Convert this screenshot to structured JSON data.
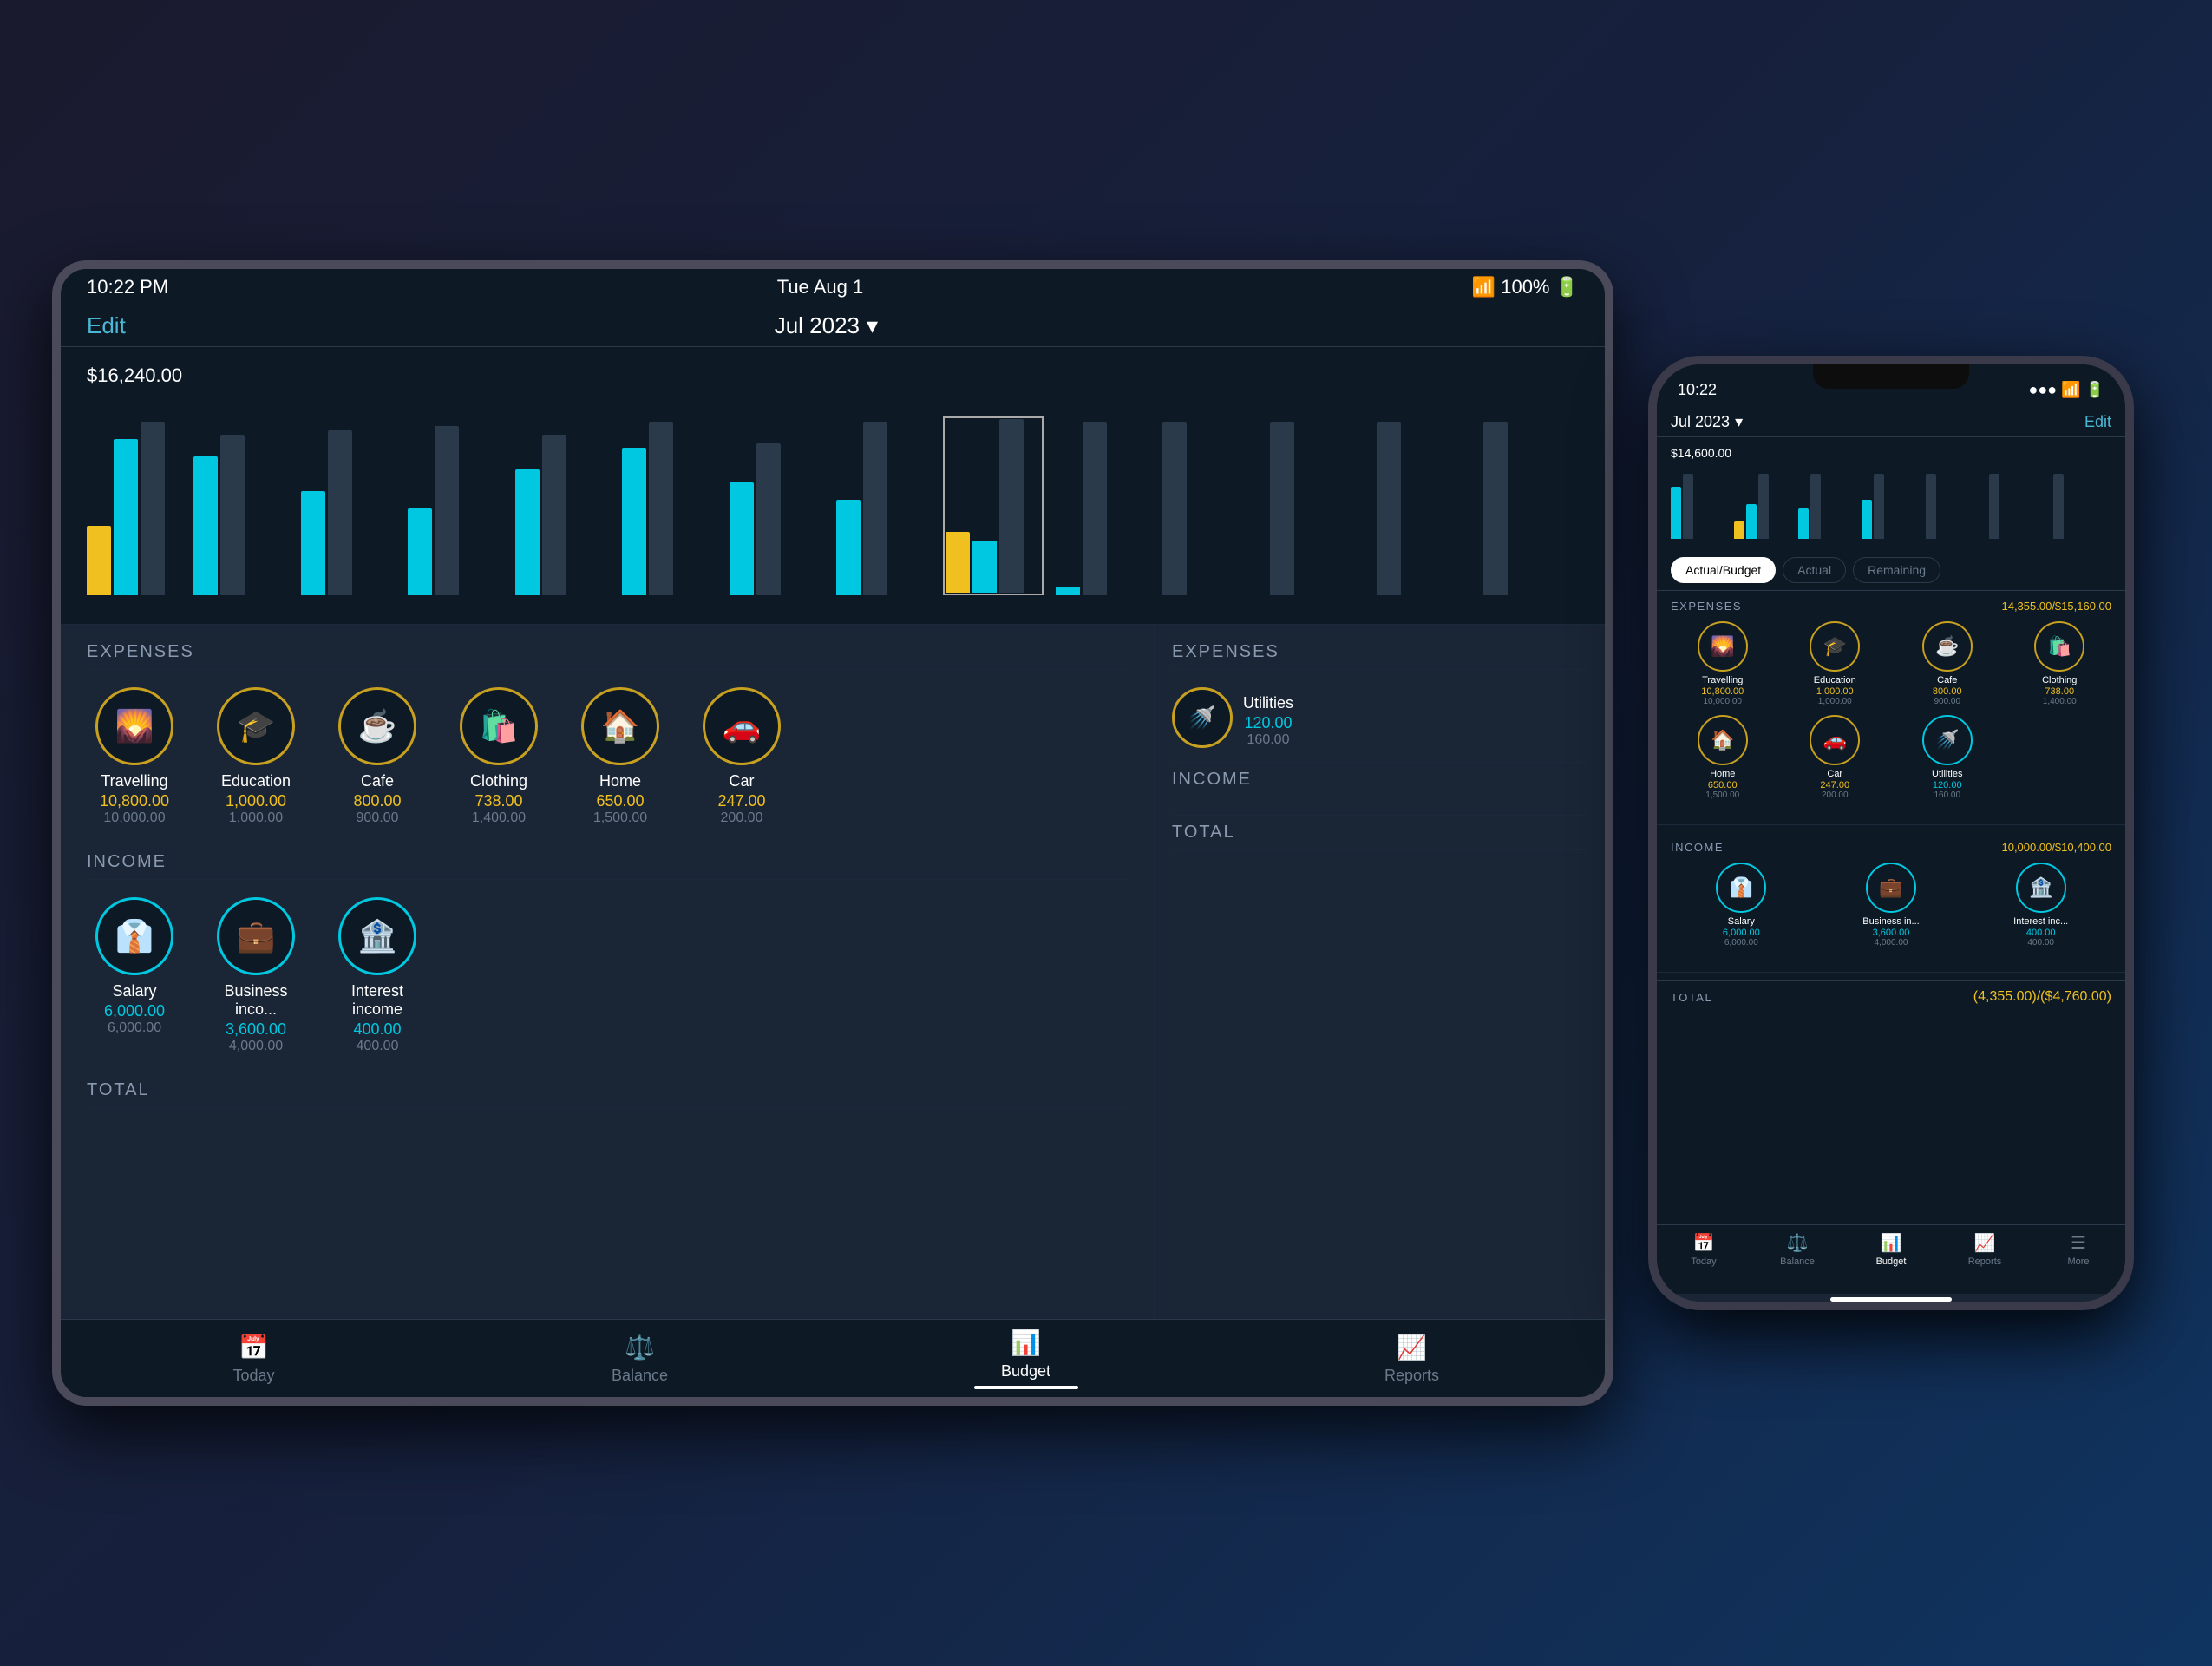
{
  "scene": {
    "background": "#1a2535"
  },
  "tablet": {
    "status_bar": {
      "time": "10:22 PM",
      "date": "Tue Aug 1",
      "wifi": "WiFi",
      "battery": "100%"
    },
    "nav": {
      "edit_label": "Edit",
      "month_label": "Jul 2023",
      "chevron": "▾"
    },
    "chart": {
      "max_label": "$16,240.00",
      "bars": [
        {
          "cyan": 180,
          "dark": 200,
          "yellow": 80
        },
        {
          "cyan": 160,
          "dark": 180,
          "yellow": 0
        },
        {
          "cyan": 120,
          "dark": 190,
          "yellow": 0
        },
        {
          "cyan": 100,
          "dark": 195,
          "yellow": 0
        },
        {
          "cyan": 145,
          "dark": 185,
          "yellow": 0
        },
        {
          "cyan": 170,
          "dark": 200,
          "yellow": 0
        },
        {
          "cyan": 130,
          "dark": 175,
          "yellow": 0
        },
        {
          "cyan": 110,
          "dark": 200,
          "yellow": 0
        },
        {
          "cyan": 60,
          "dark": 200,
          "yellow": 70
        },
        {
          "cyan": 10,
          "dark": 200,
          "yellow": 0
        },
        {
          "cyan": 0,
          "dark": 200,
          "yellow": 0
        },
        {
          "cyan": 0,
          "dark": 200,
          "yellow": 0
        },
        {
          "cyan": 0,
          "dark": 200,
          "yellow": 0
        },
        {
          "cyan": 0,
          "dark": 200,
          "yellow": 0
        }
      ]
    },
    "expenses_section": {
      "title": "EXPENSES",
      "categories": [
        {
          "name": "Travelling",
          "actual": "10,800.00",
          "budget": "10,000.00",
          "icon": "🌄",
          "color": "yellow"
        },
        {
          "name": "Education",
          "actual": "1,000.00",
          "budget": "1,000.00",
          "icon": "🎓",
          "color": "yellow"
        },
        {
          "name": "Cafe",
          "actual": "800.00",
          "budget": "900.00",
          "icon": "☕",
          "color": "yellow"
        },
        {
          "name": "Clothing",
          "actual": "738.00",
          "budget": "1,400.00",
          "icon": "🛍️",
          "color": "yellow"
        },
        {
          "name": "Home",
          "actual": "650.00",
          "budget": "1,500.00",
          "icon": "🏠",
          "color": "yellow"
        },
        {
          "name": "Car",
          "actual": "247.00",
          "budget": "200.00",
          "icon": "🚗",
          "color": "yellow"
        },
        {
          "name": "Utilities",
          "actual": "120.00",
          "budget": "160.00",
          "icon": "🚿",
          "color": "cyan"
        }
      ]
    },
    "income_section": {
      "title": "INCOME",
      "categories": [
        {
          "name": "Salary",
          "actual": "6,000.00",
          "budget": "6,000.00",
          "icon": "👔",
          "color": "yellow"
        },
        {
          "name": "Business inco...",
          "actual": "3,600.00",
          "budget": "4,000.00",
          "icon": "💼",
          "color": "yellow"
        },
        {
          "name": "Interest income",
          "actual": "400.00",
          "budget": "400.00",
          "icon": "🏦",
          "color": "yellow"
        }
      ]
    },
    "total_section": {
      "title": "TOTAL"
    },
    "tab_bar": {
      "items": [
        {
          "label": "Today",
          "icon": "📅",
          "active": false
        },
        {
          "label": "Balance",
          "icon": "⚖️",
          "active": false
        },
        {
          "label": "Budget",
          "icon": "📊",
          "active": true
        },
        {
          "label": "Reports",
          "icon": "📈",
          "active": false
        }
      ]
    }
  },
  "phone": {
    "status_bar": {
      "time": "10:22",
      "signal": "●●●",
      "wifi": "WiFi",
      "battery": "🔋"
    },
    "nav": {
      "month_label": "Jul 2023",
      "chevron": "▾",
      "edit_label": "Edit"
    },
    "chart": {
      "max_label": "$14,600.00"
    },
    "filter": {
      "buttons": [
        {
          "label": "Actual/Budget",
          "active": true
        },
        {
          "label": "Actual",
          "active": false
        },
        {
          "label": "Remaining",
          "active": false
        }
      ]
    },
    "expenses_section": {
      "title": "EXPENSES",
      "amount": "14,355.00/$15,160.00",
      "categories": [
        {
          "name": "Travelling",
          "actual": "10,800.00",
          "budget": "10,000.00",
          "icon": "🌄",
          "color": "yellow"
        },
        {
          "name": "Education",
          "actual": "1,000.00",
          "budget": "1,000.00",
          "icon": "🎓",
          "color": "yellow"
        },
        {
          "name": "Cafe",
          "actual": "800.00",
          "budget": "900.00",
          "icon": "☕",
          "color": "yellow"
        },
        {
          "name": "Clothing",
          "actual": "738.00",
          "budget": "1,400.00",
          "icon": "🛍️",
          "color": "yellow"
        },
        {
          "name": "Home",
          "actual": "650.00",
          "budget": "1,500.00",
          "icon": "🏠",
          "color": "yellow"
        },
        {
          "name": "Car",
          "actual": "247.00",
          "budget": "200.00",
          "icon": "🚗",
          "color": "yellow"
        },
        {
          "name": "Utilities",
          "actual": "120.00",
          "budget": "160.00",
          "icon": "🚿",
          "color": "cyan"
        }
      ]
    },
    "income_section": {
      "title": "INCOME",
      "amount": "10,000.00/$10,400.00",
      "categories": [
        {
          "name": "Salary",
          "actual": "6,000.00",
          "budget": "6,000.00",
          "icon": "👔",
          "color": "yellow"
        },
        {
          "name": "Business in...",
          "actual": "3,600.00",
          "budget": "4,000.00",
          "icon": "💼",
          "color": "yellow"
        },
        {
          "name": "Interest inc...",
          "actual": "400.00",
          "budget": "400.00",
          "icon": "🏦",
          "color": "yellow"
        }
      ]
    },
    "total_section": {
      "title": "TOTAL",
      "amount": "(4,355.00)/($4,760.00)"
    },
    "tab_bar": {
      "items": [
        {
          "label": "Today",
          "icon": "📅",
          "active": false
        },
        {
          "label": "Balance",
          "icon": "⚖️",
          "active": false
        },
        {
          "label": "Budget",
          "icon": "📊",
          "active": true
        },
        {
          "label": "Reports",
          "icon": "📈",
          "active": false
        },
        {
          "label": "More",
          "icon": "☰",
          "active": false
        }
      ]
    }
  }
}
